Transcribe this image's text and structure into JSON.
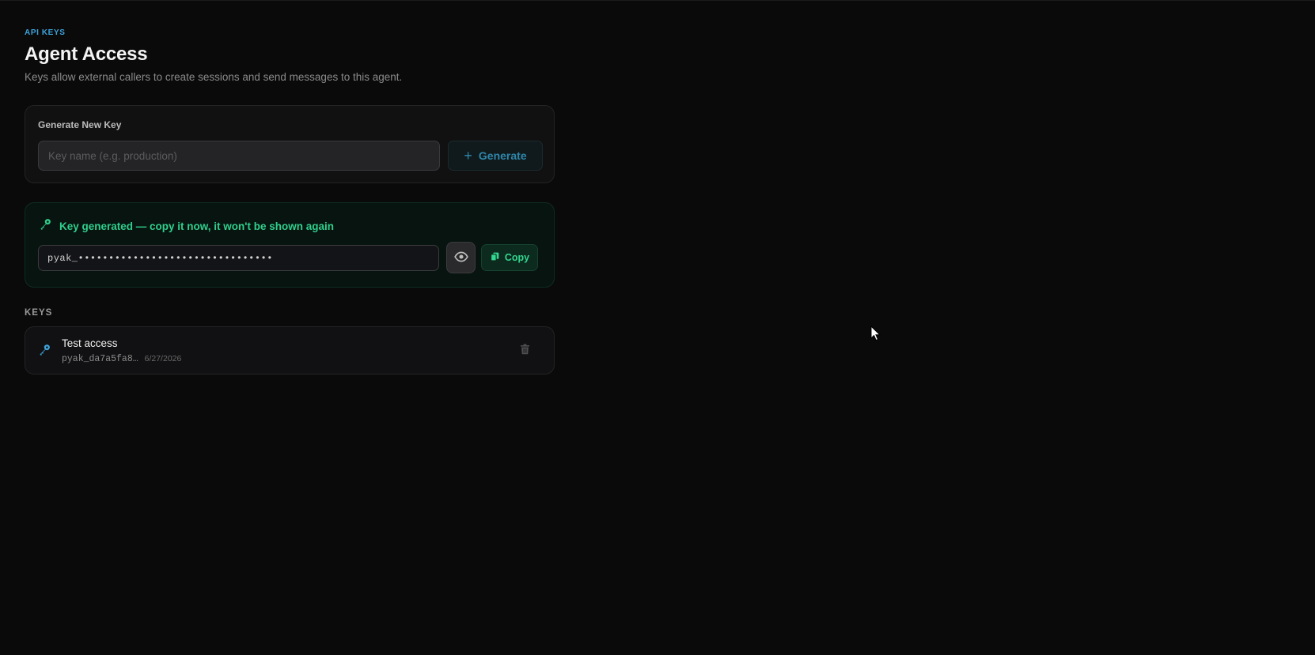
{
  "header": {
    "eyebrow": "API KEYS",
    "title": "Agent Access",
    "subtitle": "Keys allow external callers to create sessions and send messages to this agent."
  },
  "generate": {
    "label": "Generate New Key",
    "input_placeholder": "Key name (e.g. production)",
    "input_value": "",
    "button_label": "Generate",
    "button_icon": "plus-icon"
  },
  "generated_key": {
    "message": "Key generated — copy it now, it won't be shown again",
    "icon": "key-icon",
    "masked_value": "pyak_••••••••••••••••••••••••••••••••",
    "reveal_icon": "eye-icon",
    "copy_label": "Copy",
    "copy_icon": "copy-icon"
  },
  "keys": {
    "section_label": "KEYS",
    "items": [
      {
        "name": "Test access",
        "prefix": "pyak_da7a5fa8…",
        "date": "6/27/2026",
        "icon": "key-icon",
        "delete_icon": "trash-icon"
      }
    ]
  },
  "colors": {
    "background": "#0a0a0a",
    "accent_blue": "#3ea3db",
    "success_green": "#2fcf8c"
  }
}
